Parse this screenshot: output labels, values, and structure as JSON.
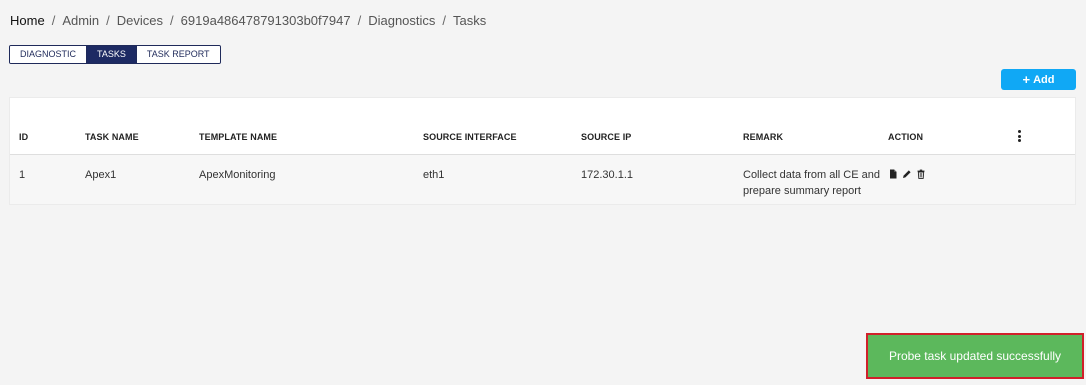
{
  "breadcrumb": [
    "Home",
    "Admin",
    "Devices",
    "6919a486478791303b0f7947",
    "Diagnostics",
    "Tasks"
  ],
  "tabs": [
    {
      "label": "DIAGNOSTIC",
      "active": false
    },
    {
      "label": "TASKS",
      "active": true
    },
    {
      "label": "TASK REPORT",
      "active": false
    }
  ],
  "add_button": {
    "label": "Add"
  },
  "table": {
    "headers": {
      "id": "ID",
      "task_name": "TASK NAME",
      "template_name": "TEMPLATE NAME",
      "source_interface": "SOURCE INTERFACE",
      "source_ip": "SOURCE IP",
      "remark": "REMARK",
      "action": "ACTION"
    },
    "rows": [
      {
        "id": "1",
        "task_name": "Apex1",
        "template_name": "ApexMonitoring",
        "source_interface": "eth1",
        "source_ip": "172.30.1.1",
        "remark": "Collect data from all CE and prepare summary report"
      }
    ]
  },
  "icons": {
    "add": "plus-icon",
    "column_menu": "vertical-dots-icon",
    "view": "file-icon",
    "edit": "pencil-icon",
    "delete": "trash-icon"
  },
  "toast": {
    "message": "Probe task updated successfully"
  },
  "colors": {
    "accent": "#10a8f5",
    "tab_active": "#1d2a63",
    "toast_bg": "#5cb85c",
    "toast_border": "#d0202a"
  }
}
